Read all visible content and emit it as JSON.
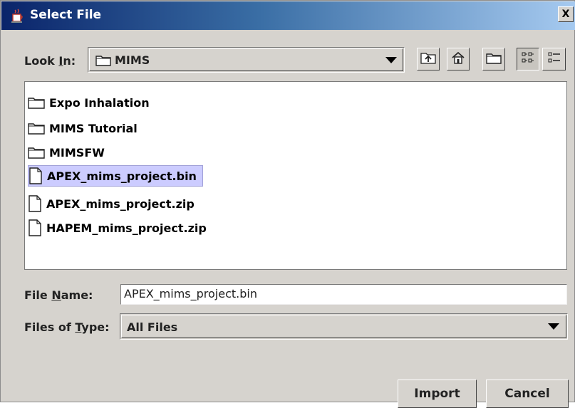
{
  "window": {
    "title": "Select File",
    "close_glyph": "X"
  },
  "lookin": {
    "label_pre": "Look ",
    "label_u": "I",
    "label_post": "n:",
    "value": "MIMS",
    "icon": "folder-icon"
  },
  "toolbar": [
    {
      "name": "up-folder-button",
      "icon": "up-folder-icon"
    },
    {
      "name": "home-button",
      "icon": "home-icon"
    },
    {
      "name": "new-folder-button",
      "icon": "new-folder-icon"
    },
    {
      "name": "list-view-button",
      "icon": "list-view-icon",
      "pressed": true
    },
    {
      "name": "details-view-button",
      "icon": "details-view-icon"
    }
  ],
  "files": [
    {
      "name": "Expo Inhalation",
      "type": "folder",
      "selected": false
    },
    {
      "name": "MIMS Tutorial",
      "type": "folder",
      "selected": false
    },
    {
      "name": "MIMSFW",
      "type": "folder",
      "selected": false
    },
    {
      "name": "APEX_mims_project.bin",
      "type": "file",
      "selected": true
    },
    {
      "name": "APEX_mims_project.zip",
      "type": "file",
      "selected": false
    },
    {
      "name": "HAPEM_mims_project.zip",
      "type": "file",
      "selected": false
    }
  ],
  "filename": {
    "label_pre": "File ",
    "label_u": "N",
    "label_post": "ame:",
    "value": "APEX_mims_project.bin"
  },
  "filetype": {
    "label_pre": "Files of ",
    "label_u": "T",
    "label_post": "ype:",
    "value": "All Files"
  },
  "buttons": {
    "import": "Import",
    "cancel": "Cancel"
  },
  "colors": {
    "selection": "#ccccff",
    "titlebar_start": "#0a246a",
    "titlebar_end": "#a6caf0",
    "dialog_bg": "#d6d3ce"
  }
}
